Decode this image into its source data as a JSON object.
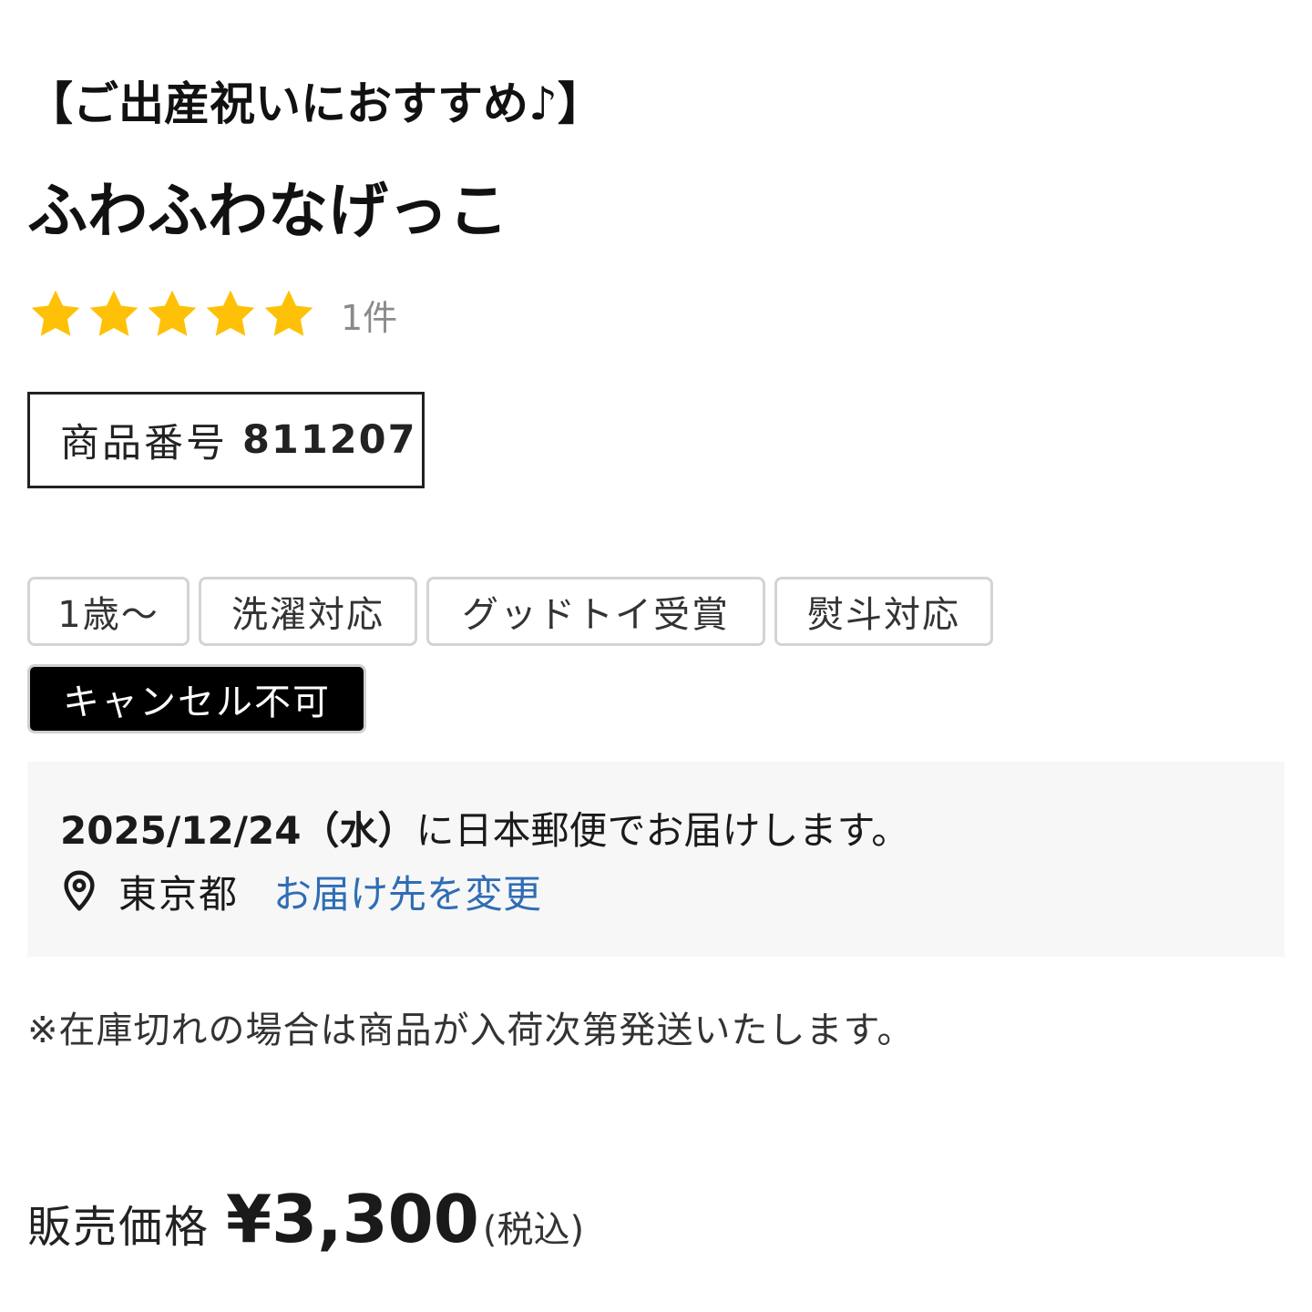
{
  "catch_copy": "【ご出産祝いにおすすめ♪】",
  "product_name": "ふわふわなげっこ",
  "rating": {
    "stars": 5,
    "max_stars": 5,
    "star_color": "#FFC107",
    "review_count_label": "1件"
  },
  "item_number": {
    "label": "商品番号",
    "value": "811207"
  },
  "tags": [
    {
      "label": "1歳〜",
      "style": "outline"
    },
    {
      "label": "洗濯対応",
      "style": "outline"
    },
    {
      "label": "グッドトイ受賞",
      "style": "outline"
    },
    {
      "label": "熨斗対応",
      "style": "outline"
    },
    {
      "label": "キャンセル不可",
      "style": "dark"
    }
  ],
  "delivery": {
    "date": "2025/12/24（水）",
    "message": "に日本郵便でお届けします。",
    "location_icon": "map-pin-icon",
    "location": "東京都",
    "change_link": "お届け先を変更",
    "link_color": "#2F6DB5"
  },
  "stock_note": "※在庫切れの場合は商品が入荷次第発送いたします。",
  "price": {
    "label": "販売価格",
    "value": "¥3,300",
    "tax_note": "(税込)"
  }
}
